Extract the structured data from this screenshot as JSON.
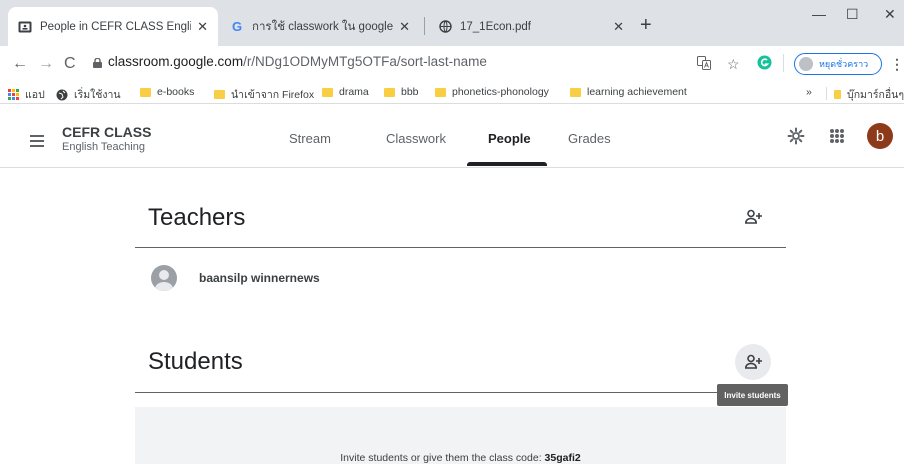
{
  "browser": {
    "tabs": [
      {
        "title": "People in CEFR CLASS English Te",
        "active": true
      },
      {
        "title": "การใช้ classwork ใน google classro",
        "active": false
      },
      {
        "title": "17_1Econ.pdf",
        "active": false
      }
    ],
    "url_host": "classroom.google.com",
    "url_path": "/r/NDg1ODMyMTg5OTFa/sort-last-name",
    "profile_label": "หยุดชั่วคราว",
    "bookmarks": [
      {
        "label": "แอป",
        "icon": "apps-grid-icon"
      },
      {
        "label": "เริ่มใช้งาน",
        "icon": "globe-icon"
      },
      {
        "label": "e-books",
        "icon": "folder-icon"
      },
      {
        "label": "นำเข้าจาก Firefox",
        "icon": "folder-icon"
      },
      {
        "label": "drama",
        "icon": "folder-icon"
      },
      {
        "label": "bbb",
        "icon": "folder-icon"
      },
      {
        "label": "phonetics-phonology",
        "icon": "folder-icon"
      },
      {
        "label": "learning achievement",
        "icon": "folder-icon"
      }
    ],
    "other_bookmarks": "บุ๊กมาร์กอื่นๆ",
    "overflow": "»"
  },
  "app": {
    "class_name": "CEFR CLASS",
    "class_section": "English Teaching",
    "nav_tabs": [
      {
        "label": "Stream",
        "active": false
      },
      {
        "label": "Classwork",
        "active": false
      },
      {
        "label": "People",
        "active": true
      },
      {
        "label": "Grades",
        "active": false
      }
    ],
    "avatar_letter": "b"
  },
  "teachers": {
    "heading": "Teachers",
    "people": [
      {
        "name": "baansilp winnernews"
      }
    ]
  },
  "students": {
    "heading": "Students",
    "tooltip": "Invite students",
    "invite_prefix": "Invite students or give them the class code: ",
    "class_code": "35gafi2"
  },
  "colors": {
    "accent": "#1a73e8",
    "avatar_bg": "#8d3a1a",
    "chrome_bg": "#dee1e6"
  }
}
